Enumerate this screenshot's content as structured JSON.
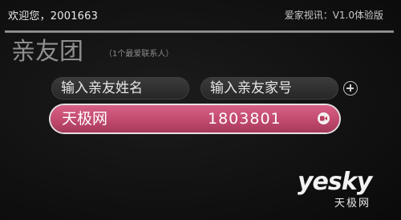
{
  "header": {
    "welcome": "欢迎您，2001663",
    "version": "爱家视讯：V1.0体验版"
  },
  "section": {
    "title": "亲友团",
    "subtitle": "（1个最爱联系人）"
  },
  "inputs": {
    "name_placeholder": "输入亲友姓名",
    "number_placeholder": "输入亲友家号"
  },
  "contacts": [
    {
      "name": "天极网",
      "number": "1803801"
    }
  ],
  "watermark": {
    "main": "yesky",
    "sub": "天极网"
  },
  "colors": {
    "accent": "#c24a6f",
    "background": "#121212"
  }
}
